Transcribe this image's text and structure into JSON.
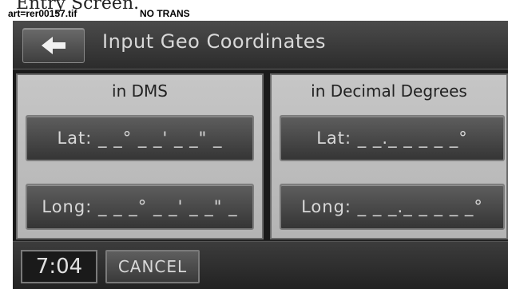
{
  "caption": {
    "top_text": "Entry Screen.",
    "art_ref": "art=rer00157.tif",
    "trans_note": "NO TRANS"
  },
  "header": {
    "title": "Input Geo Coordinates",
    "back_icon": "back-arrow-icon"
  },
  "dms_panel": {
    "title": "in DMS",
    "lat_label": "Lat: _ _° _ _' _ _\" _",
    "long_label": "Long: _ _ _° _ _' _ _\" _"
  },
  "decimal_panel": {
    "title": "in Decimal Degrees",
    "lat_label": "Lat: _ _._ _ _ _ _°",
    "long_label": "Long: _ _ _._ _ _ _ _°"
  },
  "footer": {
    "clock": "7:04",
    "cancel_label": "CANCEL"
  }
}
